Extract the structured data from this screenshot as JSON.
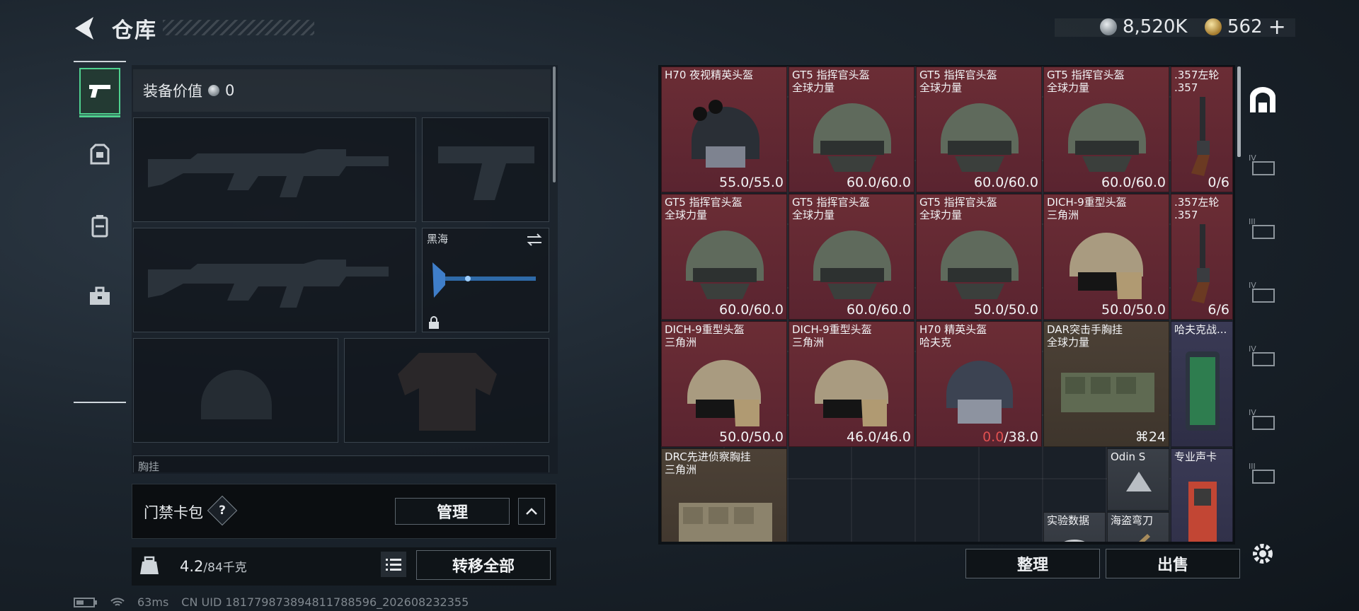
{
  "header": {
    "title": "仓库",
    "silver": "8,520K",
    "gold": "562"
  },
  "left": {
    "equip_value_label": "装备价值",
    "equip_value": "0",
    "melee_name": "黑海",
    "partial_label": "胸挂",
    "card_pack_label": "门禁卡包",
    "question": "?",
    "manage": "管理",
    "weight_current": "4.2",
    "weight_max": "/84千克",
    "transfer_all": "转移全部"
  },
  "status": {
    "ping": "63ms",
    "uid": "CN UID 181779873894811788596_202608232355"
  },
  "items": [
    {
      "name": "H70 夜视精英头盔",
      "dur": "55.0/55.0"
    },
    {
      "name": "GT5 指挥官头盔",
      "sub": "全球力量",
      "dur": "60.0/60.0"
    },
    {
      "name": "GT5 指挥官头盔",
      "sub": "全球力量",
      "dur": "60.0/60.0"
    },
    {
      "name": "GT5 指挥官头盔",
      "sub": "全球力量",
      "dur": "60.0/60.0"
    },
    {
      "name": ".357左轮",
      "sub": ".357",
      "dur": "0/6"
    },
    {
      "name": "GT5 指挥官头盔",
      "sub": "全球力量",
      "dur": "60.0/60.0"
    },
    {
      "name": "GT5 指挥官头盔",
      "sub": "全球力量",
      "dur": "60.0/60.0"
    },
    {
      "name": "GT5 指挥官头盔",
      "sub": "全球力量",
      "dur": "50.0/50.0"
    },
    {
      "name": "DICH-9重型头盔",
      "sub": "三角洲",
      "dur": "50.0/50.0"
    },
    {
      "name": ".357左轮",
      "sub": ".357",
      "dur": "6/6"
    },
    {
      "name": "DICH-9重型头盔",
      "sub": "三角洲",
      "dur": "50.0/50.0"
    },
    {
      "name": "DICH-9重型头盔",
      "sub": "三角洲",
      "dur": "46.0/46.0"
    },
    {
      "name": "H70 精英头盔",
      "sub": "哈夫克",
      "dur_low": "0.0",
      "dur": "/38.0"
    },
    {
      "name": "DAR突击手胸挂",
      "sub": "全球力量",
      "count": "24"
    },
    {
      "name": "哈夫克战..."
    },
    {
      "name": "DRC先进侦察胸挂",
      "sub": "三角洲"
    },
    {
      "name": "Odin S"
    },
    {
      "name": "专业声卡"
    },
    {
      "name": "实验数据"
    },
    {
      "name": "海盗弯刀"
    }
  ],
  "buttons": {
    "sort": "整理",
    "sell": "出售"
  }
}
